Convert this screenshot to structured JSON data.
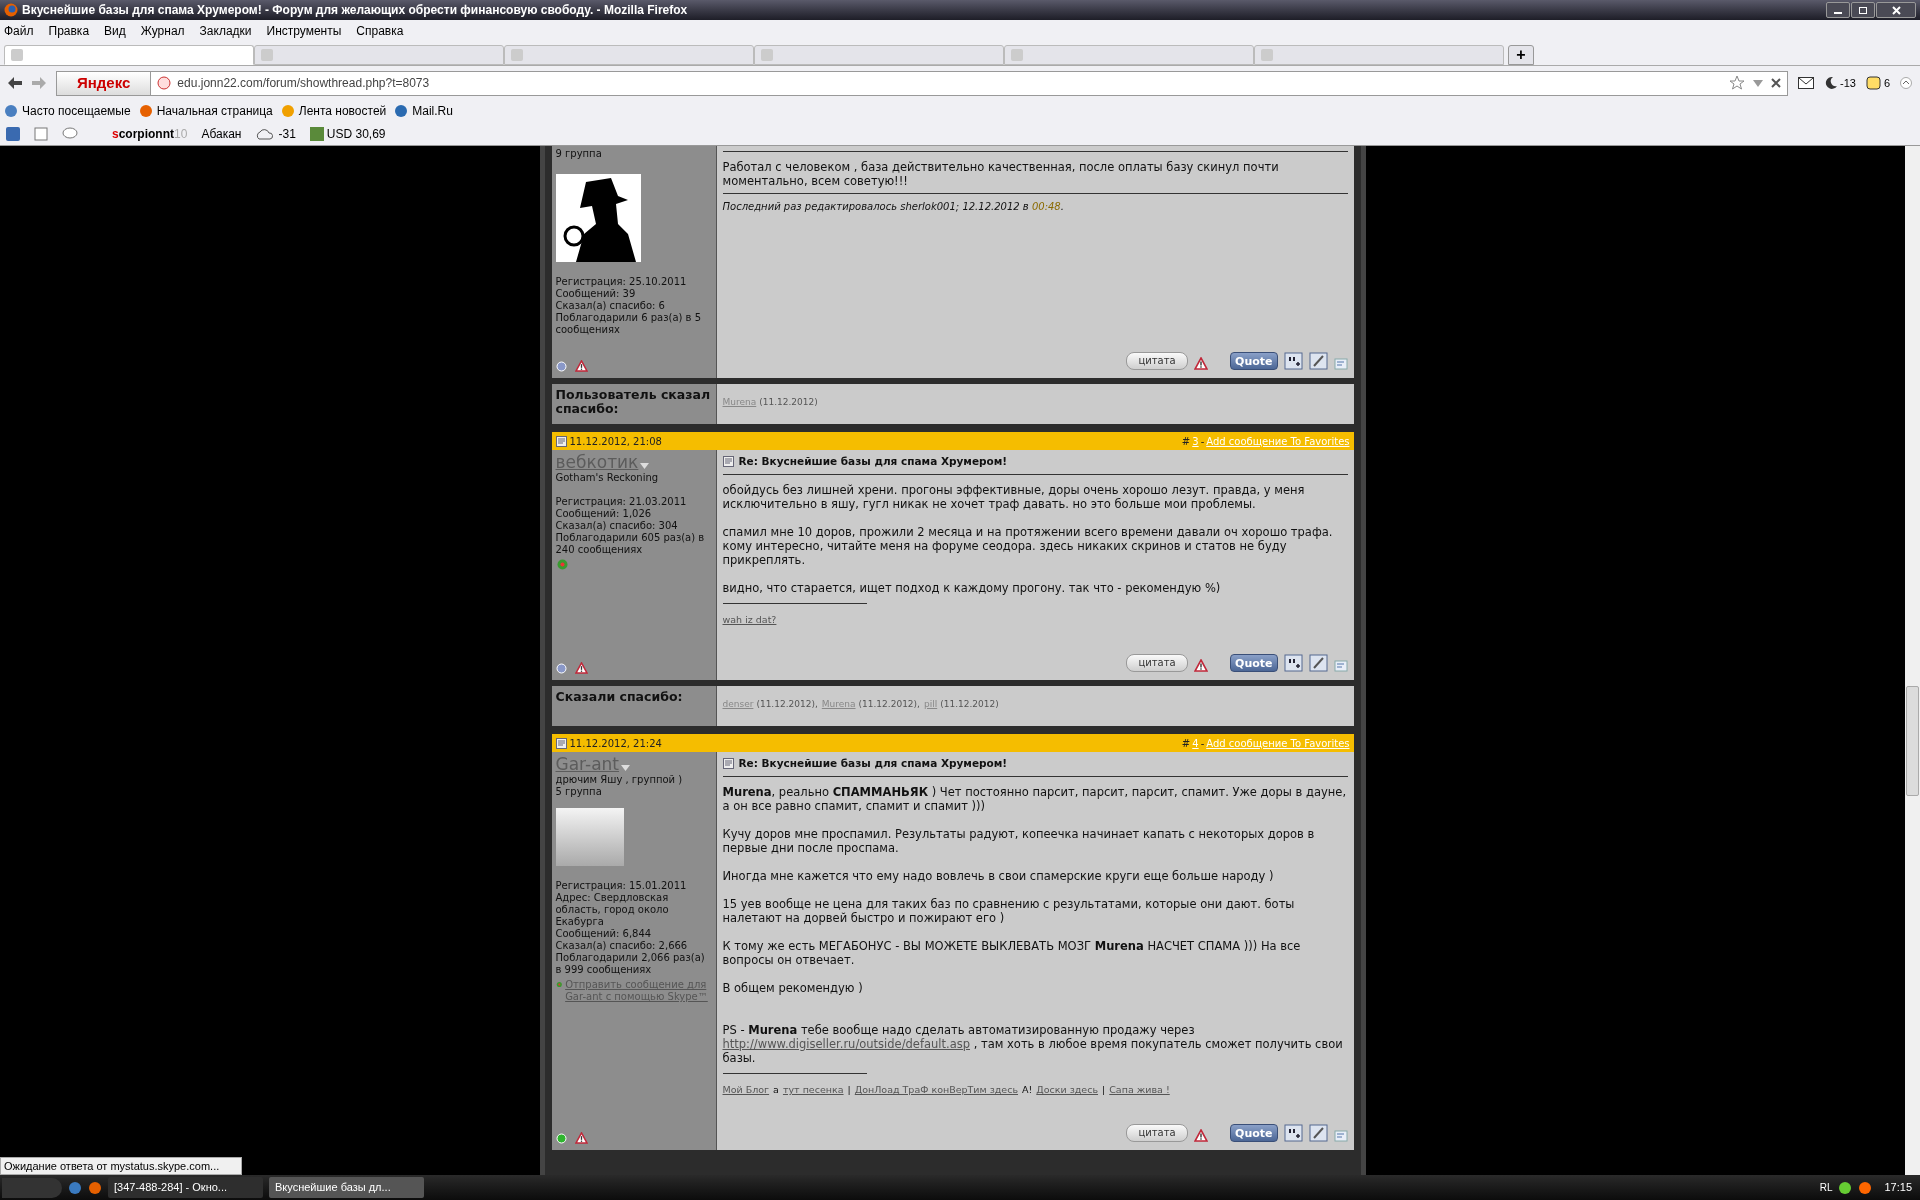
{
  "window": {
    "title": "Вкуснейшие базы для спама Хрумером! - Форум для желающих обрести финансовую свободу. - Mozilla Firefox"
  },
  "menu": [
    "Файл",
    "Правка",
    "Вид",
    "Журнал",
    "Закладки",
    "Инструменты",
    "Справка"
  ],
  "tabs": [
    {
      "selected": true
    },
    {
      "selected": false
    },
    {
      "selected": false
    },
    {
      "selected": false
    },
    {
      "selected": false
    },
    {
      "selected": false
    }
  ],
  "new_tab": "+",
  "address_bar": {
    "search_logo": "Яндекс",
    "url": "edu.jonn22.com/forum/showthread.php?t=8073",
    "weather": "-13",
    "notifications": "6"
  },
  "bookmarks": [
    "Часто посещаемые",
    "Начальная страница",
    "Лента новостей",
    "Mail.Ru"
  ],
  "toolbar": {
    "user_first": "s",
    "user_rest": "corpionnt",
    "user_suffix": "10",
    "city": "Абакан",
    "temperature": "-31",
    "currency": "USD 30,69"
  },
  "posts": [
    {
      "kind": "partial",
      "online": false,
      "user": {
        "group": "9 группа",
        "avatar": {
          "kind": "silhouette"
        },
        "stats": [
          "Регистрация: 25.10.2011",
          "Сообщений: 39",
          "Сказал(а) спасибо: 6",
          "Поблагодарили 6 раз(а) в 5 сообщениях"
        ]
      },
      "paragraphs": [
        {
          "text": "Работал с человеком , база действительно качественная, после оплаты базу скинул почти моментально, всем советую!!!"
        }
      ],
      "edit_note": {
        "text": "Последний раз редактировалось sherlok001; 12.12.2012 в ",
        "time": "00:48",
        "end": "."
      },
      "buttons": {
        "quote_image": "цитата",
        "quote": "Quote"
      },
      "thanks": {
        "label": "Пользователь сказал спасибо:",
        "users": [
          {
            "name": "Murena",
            "date": "(11.12.2012)"
          }
        ]
      }
    },
    {
      "kind": "full",
      "date": "11.12.2012, 21:08",
      "number_prefix": "#",
      "number": "3",
      "separator": "-",
      "favorites": "Add сообщение To Favorites",
      "online": false,
      "user": {
        "name": "вебкотик",
        "title": "Gotham's Reckoning",
        "stats": [
          "Регистрация: 21.03.2011",
          "Сообщений: 1,026",
          "Сказал(а) спасибо: 304",
          "Поблагодарили 605 раз(а) в 240 сообщениях"
        ]
      },
      "subject": "Re: Вкуснейшие базы для спама Хрумером!",
      "paragraphs": [
        {
          "text": "обойдусь без лишней хрени. прогоны эффективные, доры очень хорошо лезут. правда, у меня исключительно в яшу, гугл никак не хочет траф давать. но это больше мои проблемы."
        },
        {
          "text": "спамил мне 10 доров, прожили 2 месяца и на протяжении всего времени давали оч хорошо трафа. кому интересно, читайте меня на форуме сеодора. здесь никаких скринов и статов не буду прикреплять."
        },
        {
          "text": "видно, что старается, ищет подход к каждому прогону. так что - рекомендую %)"
        }
      ],
      "signature": [
        {
          "kind": "link",
          "text": "wah iz dat?"
        }
      ],
      "buttons": {
        "quote_image": "цитата",
        "quote": "Quote"
      },
      "thanks": {
        "label": "Сказали спасибо:",
        "users": [
          {
            "name": "denser",
            "date": "(11.12.2012),"
          },
          {
            "name": "Murena",
            "date": "(11.12.2012),"
          },
          {
            "name": "pill",
            "date": "(11.12.2012)"
          }
        ]
      }
    },
    {
      "kind": "full",
      "date": "11.12.2012, 21:24",
      "number_prefix": "#",
      "number": "4",
      "separator": "-",
      "favorites": "Add сообщение To Favorites",
      "online": true,
      "user": {
        "name": "Gar-ant",
        "title": "дрючим Яшу , группой )",
        "group": "5 группа",
        "avatar": {
          "kind": "photo"
        },
        "stats": [
          "Регистрация: 15.01.2011",
          "Адрес: Свердловская область, город около Екабурга",
          "Сообщений: 6,844",
          "Сказал(а) спасибо: 2,666",
          "Поблагодарили 2,066 раз(а) в 999 сообщениях"
        ],
        "skype": "Отправить сообщение для Gar-ant с помощью Skype™"
      },
      "subject": "Re: Вкуснейшие базы для спама Хрумером!",
      "paragraphs": [
        {
          "text": "**Murena**, реально **СПАММАНЬЯК** ) Чет постоянно парсит, парсит, парсит, спамит. Уже доры в дауне, а он все равно спамит, спамит и спамит )))"
        },
        {
          "text": "Кучу доров мне проспамил. Результаты радуют, копеечка начинает капать с некоторых доров в первые дни после проспама."
        },
        {
          "text": "Иногда мне кажется что ему надо вовлечь в свои спамерские круги еще больше народу )"
        },
        {
          "text": "15 уев вообще не цена для таких баз по сравнению с результатами, которые они дают. боты налетают на дорвей быстро и пожирают его )"
        },
        {
          "text": "К тому же есть МЕГАБОНУС - ВЫ МОЖЕТЕ ВЫКЛЕВАТЬ МОЗГ **Murena** НАСЧЕТ СПАМА ))) На все вопросы он отвечает."
        },
        {
          "text": "В общем рекомендую )"
        },
        {
          "text": "PS - **Murena** тебе вообще надо сделать автоматизированную продажу через ",
          "link": "http://www.digiseller.ru/outside/default.asp",
          "after": " , там хоть в любое время покупатель сможет получить свои базы."
        }
      ],
      "signature": [
        {
          "kind": "link",
          "text": "Мой Блог"
        },
        {
          "kind": "text",
          "text": "а"
        },
        {
          "kind": "link",
          "text": "тут песенка"
        },
        {
          "kind": "text",
          "text": "|"
        },
        {
          "kind": "link",
          "text": "ДонЛоад ТраФ конВерТим здесь"
        },
        {
          "kind": "text",
          "text": "A!"
        },
        {
          "kind": "link",
          "text": "Доски здесь"
        },
        {
          "kind": "text",
          "text": "|"
        },
        {
          "kind": "link",
          "text": "Сапа жива !"
        }
      ],
      "buttons": {
        "quote_image": "цитата",
        "quote": "Quote"
      }
    }
  ],
  "status": "Ожидание ответа от mystatus.skype.com...",
  "taskbar": {
    "items": [
      {
        "label": "[347-488-284] - Окно...",
        "selected": false
      },
      {
        "label": "Вкуснейшие базы дл...",
        "selected": true
      }
    ],
    "language": "RL",
    "clock": "17:15"
  }
}
